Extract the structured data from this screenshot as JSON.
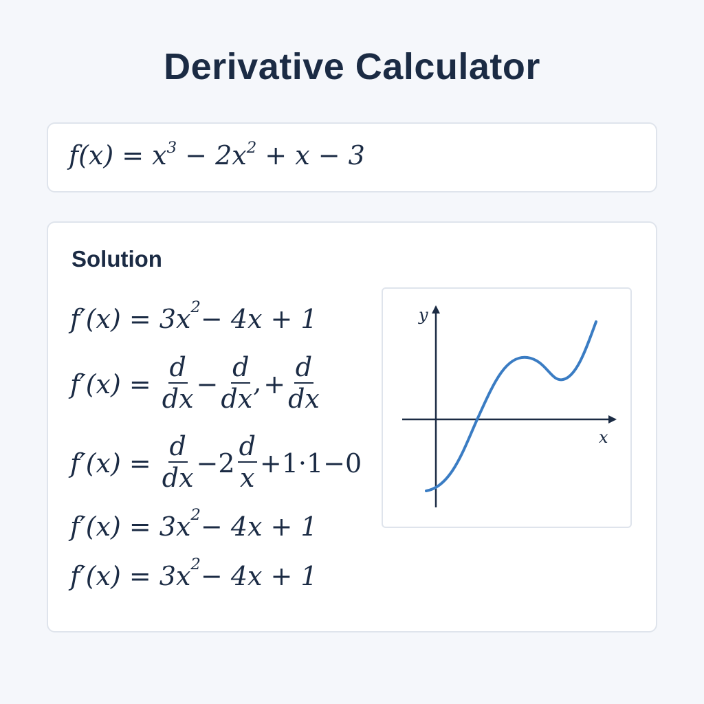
{
  "page": {
    "title": "Derivative Calculator"
  },
  "input": {
    "expression": {
      "fx": "f(x) = x",
      "exp3": "3",
      "mid": " − 2x",
      "exp2": "2",
      "tail": " + x − 3"
    }
  },
  "solution": {
    "heading": "Solution",
    "steps": [
      {
        "lhs": "f′(x) = 3x",
        "exp": "2",
        "rest": " − 4x + 1"
      },
      {
        "lhs": "f′(x) = ",
        "f1_num": "d",
        "f1_den": "dx",
        "op1": "−",
        "f2_num": "d",
        "f2_den": "dx’",
        "op2": "+",
        "f3_num": "d",
        "f3_den": "dx"
      },
      {
        "lhs": "f′(x) = ",
        "f1_num": "d",
        "f1_den": "dx",
        "mid": "−2",
        "f2_num": "d",
        "f2_den": "x",
        "rest": "+1·1−0"
      },
      {
        "lhs": "f′(x) = 3x",
        "exp": "2",
        "rest": " − 4x + 1"
      },
      {
        "lhs": "f′(x) = 3x",
        "exp": "2",
        "rest": " − 4x + 1"
      }
    ]
  },
  "graph": {
    "x_axis_label": "x",
    "y_axis_label": "y",
    "curve_color": "#3a7cc3",
    "axis_color": "#1b2b44"
  }
}
